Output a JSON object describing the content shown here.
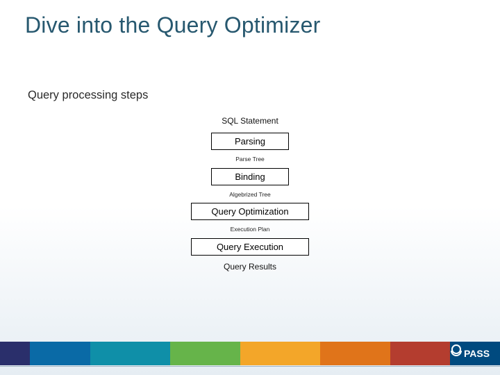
{
  "title": "Dive into the Query Optimizer",
  "subtitle": "Query processing steps",
  "diagram": {
    "start_label": "SQL Statement",
    "end_label": "Query Results",
    "steps": [
      {
        "box": "Parsing",
        "edge_out": "Parse Tree"
      },
      {
        "box": "Binding",
        "edge_out": "Algebrized Tree"
      },
      {
        "box": "Query Optimization",
        "edge_out": "Execution Plan"
      },
      {
        "box": "Query Execution",
        "edge_out": ""
      }
    ]
  },
  "logo_text": "PASS"
}
